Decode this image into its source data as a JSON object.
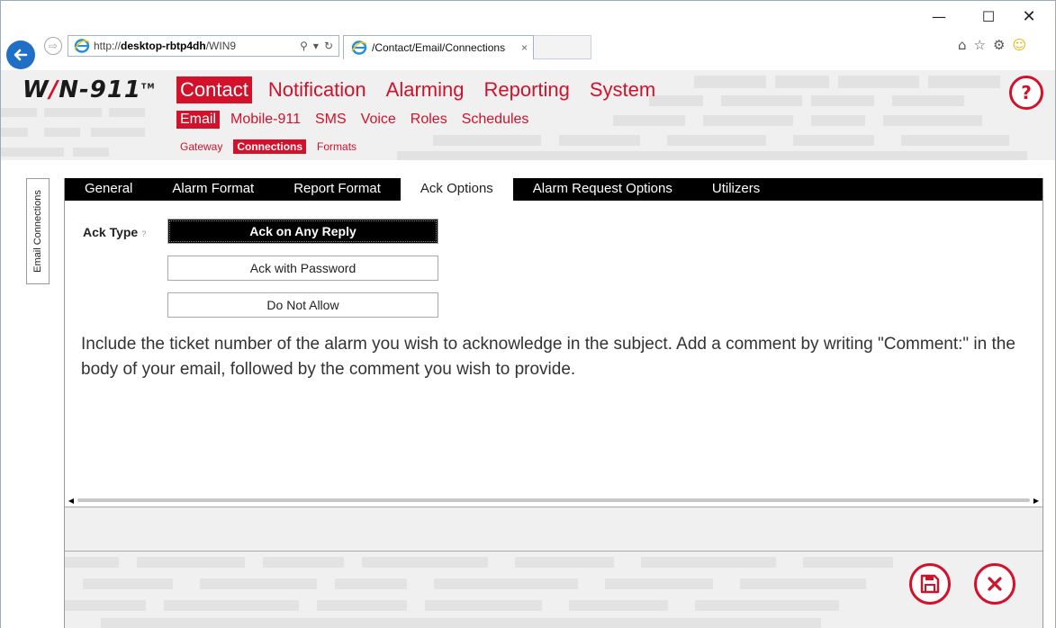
{
  "browser": {
    "url_prefix": "http://",
    "url_host": "desktop-rbtp4dh",
    "url_rest": "/WIN9",
    "tab_title": "/Contact/Email/Connections",
    "tab_close": "×",
    "win_min": "—",
    "win_max": "☐",
    "win_close": "✕",
    "fwd_arrow": "⇨",
    "search_glyph": "⚲",
    "dropdown_glyph": "▾",
    "refresh_glyph": "↻",
    "home_glyph": "⌂",
    "star_glyph": "☆",
    "gear_glyph": "⚙",
    "smiley_glyph": "☺"
  },
  "app": {
    "logo_pre": "W",
    "logo_slash": "/",
    "logo_post": "N-911",
    "logo_tm": "TM",
    "help_label": "?"
  },
  "nav1": [
    "Contact",
    "Notification",
    "Alarming",
    "Reporting",
    "System"
  ],
  "nav2": [
    "Email",
    "Mobile-911",
    "SMS",
    "Voice",
    "Roles",
    "Schedules"
  ],
  "nav3": [
    "Gateway",
    "Connections",
    "Formats"
  ],
  "side_tab": "Email Connections",
  "tabs": [
    "General",
    "Alarm Format",
    "Report Format",
    "Ack Options",
    "Alarm Request Options",
    "Utilizers"
  ],
  "ack": {
    "label": "Ack Type",
    "hint": "?",
    "options": [
      "Ack on Any Reply",
      "Ack with Password",
      "Do Not Allow"
    ],
    "selected": "Ack on Any Reply"
  },
  "description": "Include the ticket number of the alarm you wish to acknowledge in the subject. Add a comment by writing \"Comment:\" in the body of your email, followed by the comment you wish to provide.",
  "scroll": {
    "left": "◀",
    "right": "▶"
  },
  "colors": {
    "brand_red": "#d3112a",
    "tab_bar": "#000000",
    "ie_blue": "#1f6fc6"
  },
  "icons": {
    "save": "save-icon",
    "cancel": "cancel-icon"
  }
}
